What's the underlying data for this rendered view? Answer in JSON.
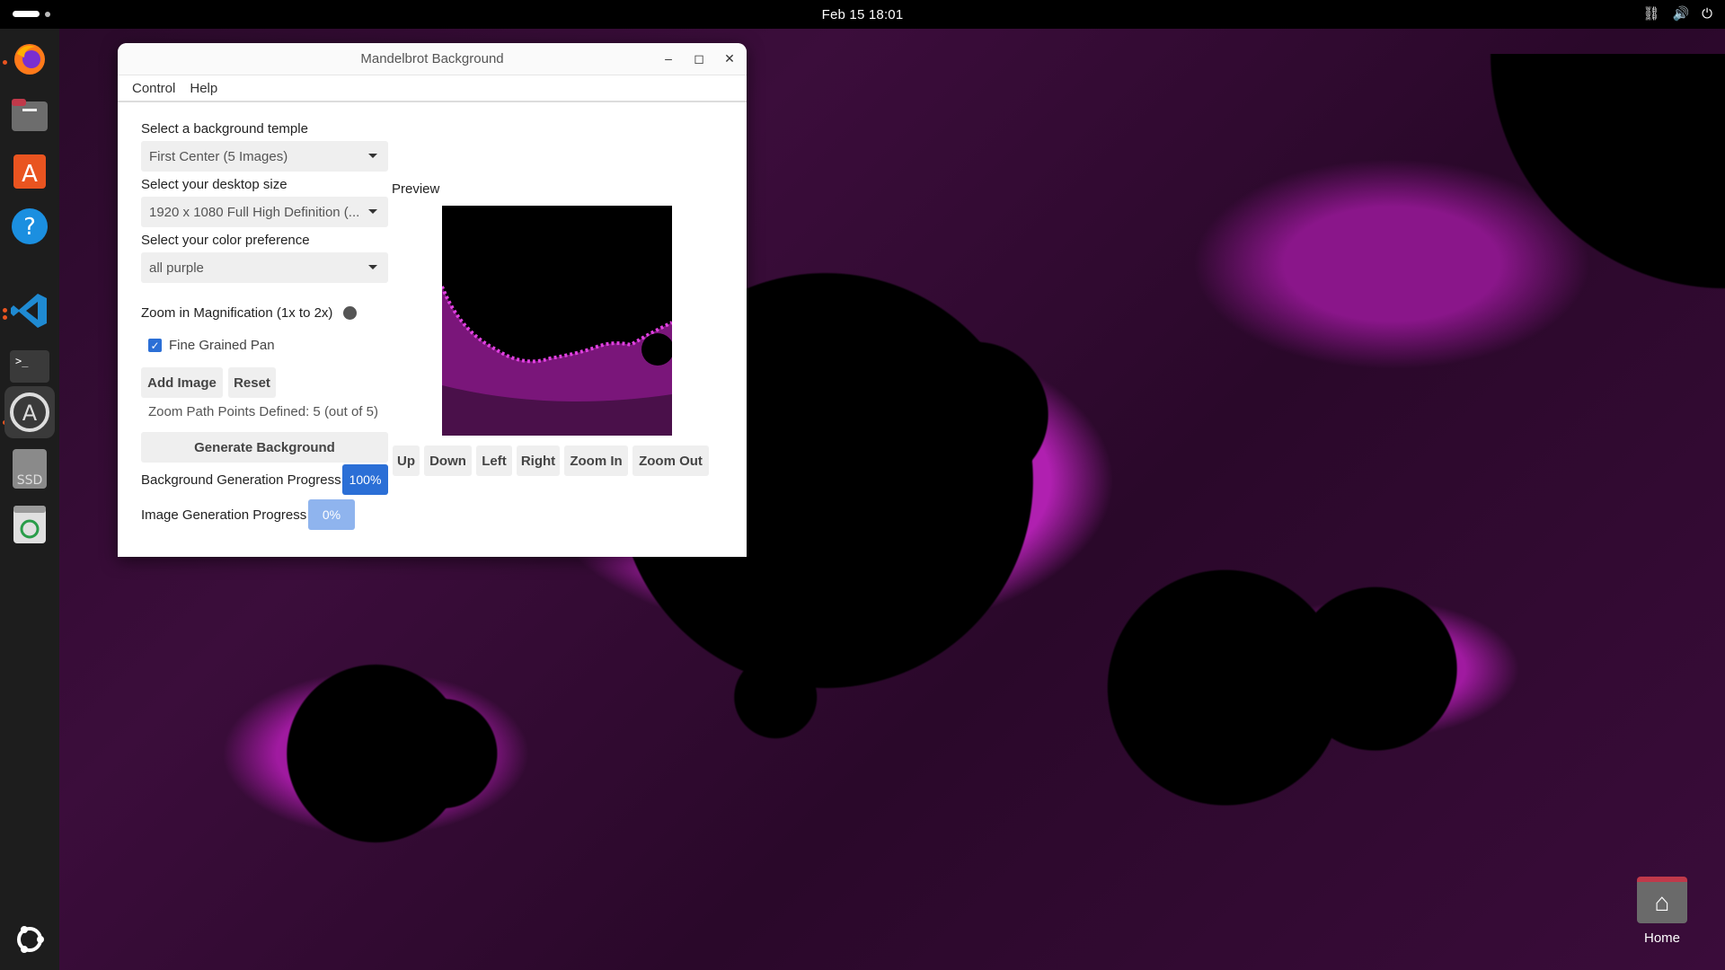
{
  "topbar": {
    "clock": "Feb 15  18:01",
    "tray_network_icon": "network-icon",
    "tray_volume_icon": "volume-icon",
    "tray_power_icon": "power-icon"
  },
  "dock": {
    "items": [
      {
        "name": "firefox",
        "icon": "firefox-icon",
        "running": true
      },
      {
        "name": "files",
        "icon": "files-icon",
        "running": false
      },
      {
        "name": "app-center",
        "icon": "app-center-icon",
        "running": false
      },
      {
        "name": "help",
        "icon": "help-icon",
        "running": false
      },
      {
        "name": "vscode",
        "icon": "vscode-icon",
        "running": true
      },
      {
        "name": "terminal",
        "icon": "terminal-icon",
        "running": false
      },
      {
        "name": "software-updater",
        "icon": "software-updater-icon",
        "running": true
      },
      {
        "name": "ssd-drive",
        "icon": "ssd-icon",
        "label": "SSD",
        "running": false
      },
      {
        "name": "trash",
        "icon": "trash-icon",
        "running": false
      },
      {
        "name": "show-apps",
        "icon": "ubuntu-logo-icon",
        "running": false
      }
    ]
  },
  "window": {
    "title": "Mandelbrot Background",
    "menu": [
      "Control",
      "Help"
    ],
    "template_label": "Select a background temple",
    "template_value": "First Center (5 Images)",
    "size_label": "Select your desktop size",
    "size_value": "1920 x 1080 Full High Definition (...",
    "color_label": "Select your color preference",
    "color_value": "all purple",
    "zoom_label": "Zoom in Magnification (1x to 2x)",
    "fine_pan_label": "Fine Grained Pan",
    "fine_pan_checked": true,
    "add_image": "Add Image",
    "reset": "Reset",
    "zoom_points": "Zoom Path Points Defined: 5 (out of 5)",
    "generate": "Generate Background",
    "bg_progress_label": "Background Generation Progress",
    "bg_progress_value": "100%",
    "img_progress_label": "Image Generation Progress",
    "img_progress_value": "0%",
    "preview_label": "Preview",
    "nav_buttons": [
      "Up",
      "Down",
      "Left",
      "Right",
      "Zoom In",
      "Zoom Out"
    ],
    "colors": {
      "accent": "#2b6fd6",
      "progress_full": "#2b6fd6",
      "progress_empty": "#8fb4ee",
      "fractal": "#b020b0"
    }
  },
  "desktop": {
    "home_label": "Home"
  }
}
